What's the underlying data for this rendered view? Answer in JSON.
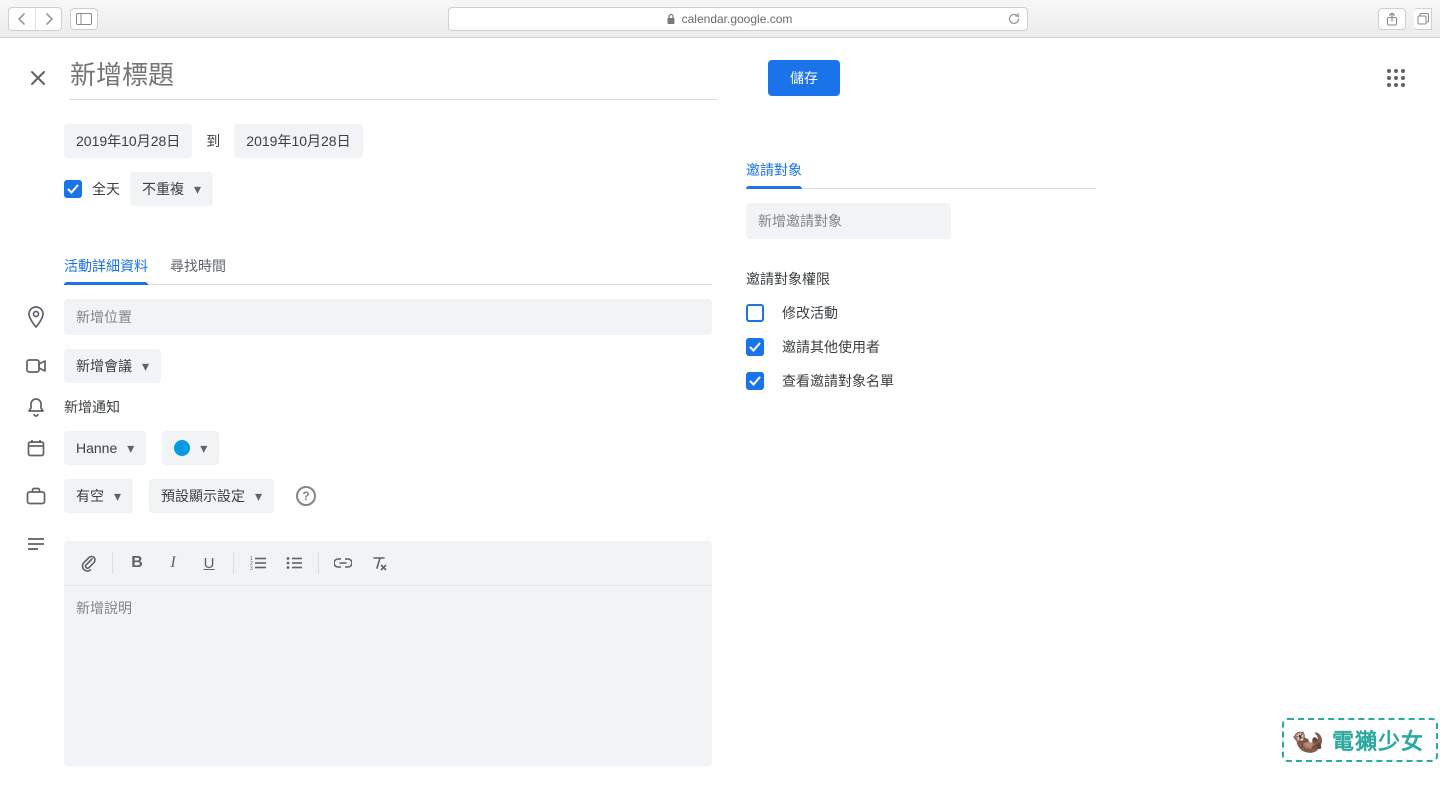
{
  "browser": {
    "url_host": "calendar.google.com"
  },
  "header": {
    "title_placeholder": "新增標題",
    "save_label": "儲存"
  },
  "dates": {
    "start": "2019年10月28日",
    "to_label": "到",
    "end": "2019年10月28日",
    "allday_label": "全天",
    "allday_checked": true,
    "repeat_label": "不重複"
  },
  "tabs": {
    "details": "活動詳細資料",
    "find_time": "尋找時間"
  },
  "fields": {
    "location_placeholder": "新增位置",
    "conference_label": "新增會議",
    "notification_label": "新增通知",
    "calendar_owner": "Hanne",
    "availability_label": "有空",
    "visibility_label": "預設顯示設定",
    "description_placeholder": "新增說明"
  },
  "guests": {
    "tab_label": "邀請對象",
    "add_placeholder": "新增邀請對象",
    "permissions_title": "邀請對象權限",
    "perm_modify": "修改活動",
    "perm_invite": "邀請其他使用者",
    "perm_see_list": "查看邀請對象名單",
    "perm_modify_checked": false,
    "perm_invite_checked": true,
    "perm_see_list_checked": true
  },
  "watermark": {
    "text": "電獺少女"
  }
}
